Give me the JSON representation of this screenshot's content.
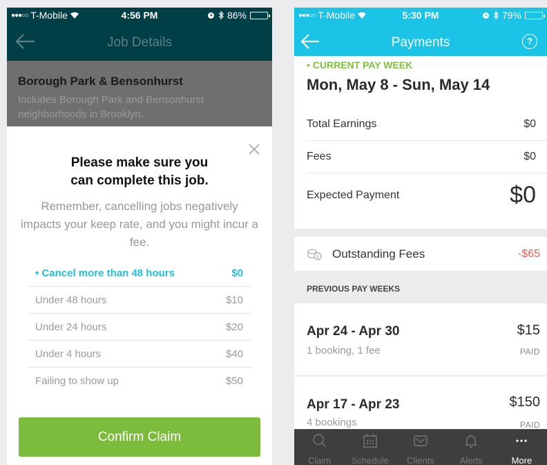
{
  "left": {
    "status": {
      "carrier": "T-Mobile",
      "time": "4:56 PM",
      "battery": "86%",
      "battery_level": 0.86
    },
    "nav_title": "Job Details",
    "job": {
      "title": "Borough Park & Bensonhurst",
      "subtitle": "Includes Borough Park and Bensonhurst neighborhoods in Brooklyn."
    },
    "modal": {
      "title_line1": "Please make sure you",
      "title_line2": "can complete this job.",
      "body": "Remember, cancelling jobs negatively impacts your keep rate, and you might incur a fee.",
      "fees": [
        {
          "label": "• Cancel more than 48 hours",
          "value": "$0"
        },
        {
          "label": "Under 48 hours",
          "value": "$10"
        },
        {
          "label": "Under 24 hours",
          "value": "$20"
        },
        {
          "label": "Under 4 hours",
          "value": "$40"
        },
        {
          "label": "Failing to show up",
          "value": "$50"
        }
      ],
      "confirm_label": "Confirm Claim"
    },
    "colors": {
      "header": "#013f46",
      "accent": "#1ec0dc",
      "button": "#7cbc3c"
    }
  },
  "right": {
    "status": {
      "carrier": "T-Mobile",
      "time": "5:30 PM",
      "battery": "79%",
      "battery_level": 0.79
    },
    "nav_title": "Payments",
    "help_label": "?",
    "current": {
      "label": "• CURRENT PAY WEEK",
      "range": "Mon, May 8 - Sun, May 14",
      "rows": [
        {
          "label": "Total Earnings",
          "value": "$0"
        },
        {
          "label": "Fees",
          "value": "$0"
        },
        {
          "label": "Expected Payment",
          "value": "$0"
        }
      ]
    },
    "outstanding": {
      "label": "Outstanding Fees",
      "value": "-$65"
    },
    "previous_label": "PREVIOUS PAY WEEKS",
    "weeks": [
      {
        "range": "Apr 24 - Apr 30",
        "sub": "1 booking, 1 fee",
        "amount": "$15",
        "status": "PAID"
      },
      {
        "range": "Apr 17 - Apr 23",
        "sub": "4 bookings",
        "amount": "$150",
        "status": "PAID"
      }
    ],
    "tabs": [
      {
        "label": "Claim",
        "icon": "search-icon"
      },
      {
        "label": "Schedule",
        "icon": "calendar-icon"
      },
      {
        "label": "Clients",
        "icon": "envelope-icon"
      },
      {
        "label": "Alerts",
        "icon": "bell-icon"
      },
      {
        "label": "More",
        "icon": "more-icon"
      }
    ],
    "colors": {
      "header": "#1bc4e6",
      "green": "#7dc142",
      "negative": "#f2594b",
      "tabbar": "#3e3e3e"
    }
  }
}
